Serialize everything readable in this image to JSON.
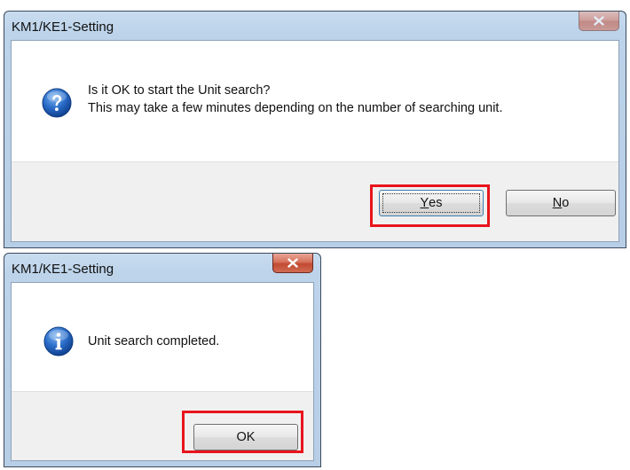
{
  "dialog_confirm": {
    "title": "KM1/KE1-Setting",
    "icon": "question-icon",
    "message_line1": "Is it OK to start the Unit search?",
    "message_line2": "This may take a few minutes depending on the number of searching unit.",
    "buttons": {
      "yes_mnemonic": "Y",
      "yes_rest": "es",
      "no_mnemonic": "N",
      "no_rest": "o"
    },
    "close_icon": "close-icon"
  },
  "dialog_info": {
    "title": "KM1/KE1-Setting",
    "icon": "info-icon",
    "message": "Unit search completed.",
    "buttons": {
      "ok_label": "OK"
    },
    "close_icon": "close-icon"
  },
  "annotations": {
    "highlight_color": "#e8141c"
  }
}
